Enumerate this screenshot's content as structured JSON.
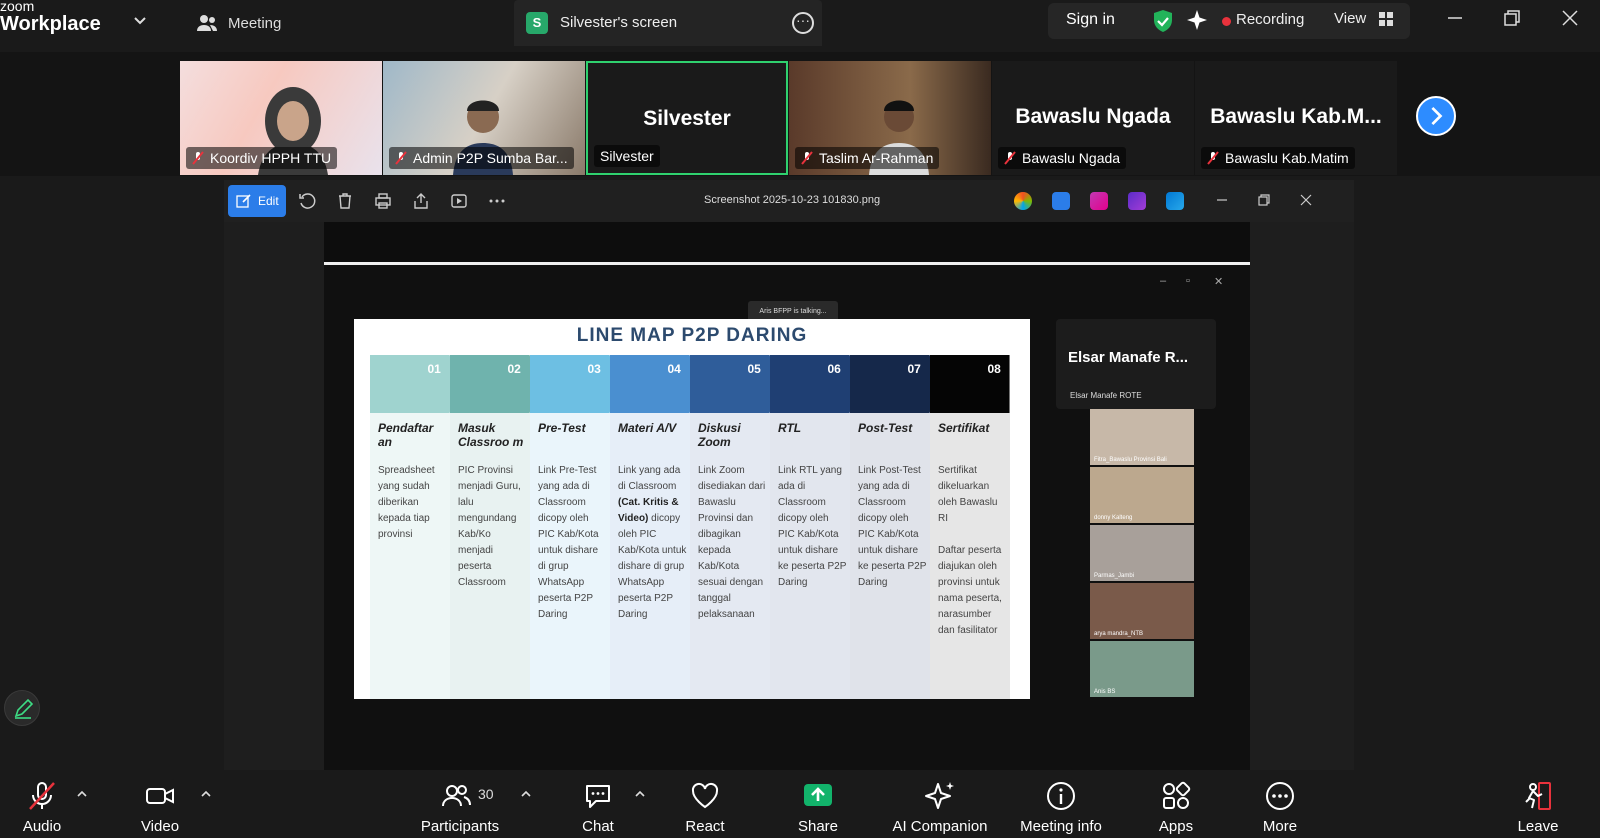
{
  "app": {
    "brand_line1": "zoom",
    "brand_line2": "Workplace"
  },
  "header": {
    "meeting_label": "Meeting",
    "share_tab": {
      "badge": "S",
      "label": "Silvester's screen"
    },
    "signin": "Sign in",
    "recording": "Recording",
    "view": "View"
  },
  "thumbnails": [
    {
      "name": "Koordiv HPPH TTU",
      "muted": true
    },
    {
      "name": "Admin P2P Sumba Bar...",
      "muted": true
    },
    {
      "name": "Silvester",
      "big": "Silvester",
      "muted": false,
      "active": true
    },
    {
      "name": "Taslim  Ar-Rahman",
      "muted": true
    },
    {
      "name": "Bawaslu Ngada",
      "big": "Bawaslu Ngada",
      "muted": true
    },
    {
      "name": "Bawaslu Kab.Matim",
      "big": "Bawaslu  Kab.M...",
      "muted": true
    }
  ],
  "viewer": {
    "edit_label": "Edit",
    "filename": "Screenshot 2025-10-23 101830.png",
    "talking": "Aris BFPP is talking..."
  },
  "slide": {
    "title": "LINE MAP P2P DARING",
    "columns": [
      {
        "num": "01",
        "title": "Pendaftar an",
        "body": "Spreadsheet yang sudah diberikan kepada tiap provinsi",
        "color": "#9fd3cf"
      },
      {
        "num": "02",
        "title": "Masuk Classroo m",
        "body": "PIC Provinsi menjadi Guru, lalu mengundang Kab/Ko menjadi peserta Classroom",
        "color": "#6fb3ad"
      },
      {
        "num": "03",
        "title": "Pre-Test",
        "body": "Link Pre-Test yang ada di Classroom dicopy oleh PIC Kab/Kota untuk dishare di grup WhatsApp peserta P2P Daring",
        "color": "#6dbfe3"
      },
      {
        "num": "04",
        "title": "Materi A/V",
        "body_pre": "Link yang ada di Classroom",
        "body_bold": "(Cat. Kritis & Video)",
        "body_post": "dicopy oleh PIC Kab/Kota untuk dishare di grup WhatsApp peserta P2P Daring",
        "color": "#4a8fd0"
      },
      {
        "num": "05",
        "title": "Diskusi Zoom",
        "body": "Link Zoom disediakan dari Bawaslu Provinsi dan dibagikan kepada Kab/Kota sesuai dengan tanggal pelaksanaan",
        "color": "#2f5d9a"
      },
      {
        "num": "06",
        "title": "RTL",
        "body": "Link RTL yang ada di Classroom dicopy oleh PIC Kab/Kota untuk dishare ke peserta P2P Daring",
        "color": "#1f3f73"
      },
      {
        "num": "07",
        "title": "Post-Test",
        "body": "Link Post-Test yang ada di Classroom dicopy oleh PIC Kab/Kota untuk dishare ke peserta P2P Daring",
        "color": "#15284a"
      },
      {
        "num": "08",
        "title": "Sertifikat",
        "body": "Sertifikat dikeluarkan oleh Bawaslu RI\n\nDaftar peserta diajukan oleh provinsi untuk nama peserta, narasumber dan fasilitator",
        "color": "#050505"
      }
    ]
  },
  "side_panel": {
    "speaker": "Elsar Manafe R...",
    "speaker_label": "Elsar Manafe ROTE",
    "minis": [
      "Fitra_Bawaslu Provinsi Bali",
      "donny Kalteng",
      "Parmas_Jambi",
      "arya mandra_NTB",
      "Anis BS"
    ]
  },
  "toolbar": {
    "audio": "Audio",
    "video": "Video",
    "participants": "Participants",
    "participants_count": "30",
    "chat": "Chat",
    "react": "React",
    "share": "Share",
    "ai": "AI Companion",
    "info": "Meeting info",
    "apps": "Apps",
    "more": "More",
    "leave": "Leave"
  },
  "colors": {
    "accent": "#2d8cff",
    "share_green": "#12b36b",
    "rec_red": "#e8323c",
    "active_border": "#2fd16e"
  }
}
